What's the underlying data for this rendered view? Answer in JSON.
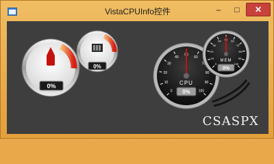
{
  "window": {
    "title": "VistaCPUInfo控件",
    "controls": {
      "minimize": "–",
      "maximize": "□",
      "close": "✕"
    }
  },
  "gauges_light": {
    "cpu_percent": "0%",
    "mem_percent": "0%",
    "cpu_icon": "chip-icon",
    "mem_icon": "memory-icon"
  },
  "gauges_dark": {
    "cpu_label": "CPU",
    "mem_label": "MEM",
    "cpu_percent": "0%",
    "mem_percent": "0%",
    "cpu_ticks": [
      "0",
      "10",
      "20",
      "30",
      "40",
      "50",
      "60",
      "70",
      "80",
      "90",
      "100"
    ],
    "mem_ticks": [
      "0",
      "10",
      "20",
      "30",
      "40",
      "50",
      "60",
      "70",
      "80",
      "90",
      "100"
    ]
  },
  "watermark": "CSASPX",
  "colors": {
    "window_frame": "#e9a84a",
    "client_bg": "#3e3e3e",
    "needle": "#c4120f"
  }
}
